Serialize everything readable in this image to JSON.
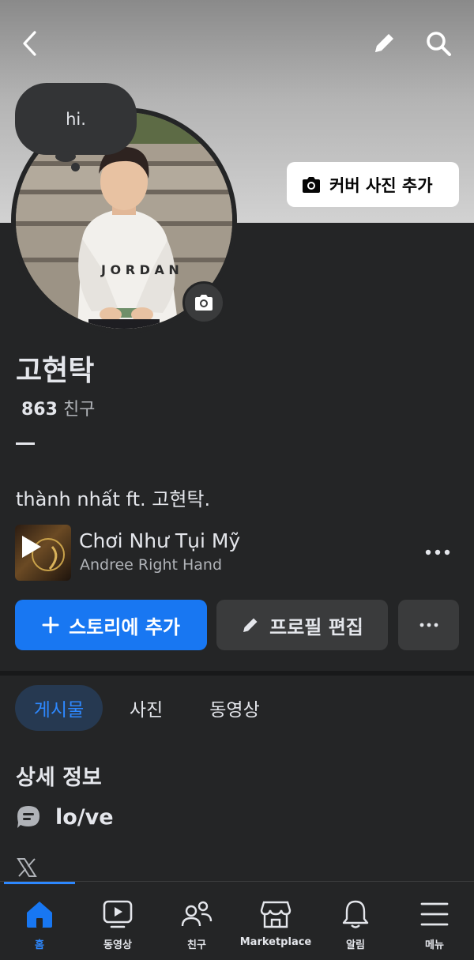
{
  "header": {
    "back_icon": "chevron-left-icon",
    "edit_icon": "pencil-icon",
    "search_icon": "search-icon"
  },
  "cover": {
    "add_cover_label": "커버 사진 추가"
  },
  "note": {
    "text": "hi."
  },
  "profile": {
    "name": "고현탁",
    "friends_count": "863",
    "friends_label": "친구",
    "bio": "thành nhất ft. 고현탁."
  },
  "music": {
    "title": "Chơi Như Tụi Mỹ",
    "artist": "Andree Right Hand",
    "more_label": "•••"
  },
  "actions": {
    "add_story_label": "스토리에 추가",
    "edit_profile_label": "프로필 편집",
    "more_label": "•••"
  },
  "tabs": [
    {
      "label": "게시물",
      "active": true
    },
    {
      "label": "사진",
      "active": false
    },
    {
      "label": "동영상",
      "active": false
    }
  ],
  "details": {
    "title": "상세 정보",
    "note": "lo/ve",
    "x_label": "𝕏"
  },
  "nav": [
    {
      "label": "홈",
      "icon": "home-icon",
      "active": true
    },
    {
      "label": "동영상",
      "icon": "video-icon",
      "active": false
    },
    {
      "label": "친구",
      "icon": "friends-icon",
      "active": false
    },
    {
      "label": "Marketplace",
      "icon": "marketplace-icon",
      "active": false
    },
    {
      "label": "알림",
      "icon": "bell-icon",
      "active": false
    },
    {
      "label": "메뉴",
      "icon": "menu-icon",
      "active": false
    }
  ],
  "colors": {
    "accent": "#1877f2",
    "background": "#242526",
    "active_tab_bg": "#263951"
  }
}
